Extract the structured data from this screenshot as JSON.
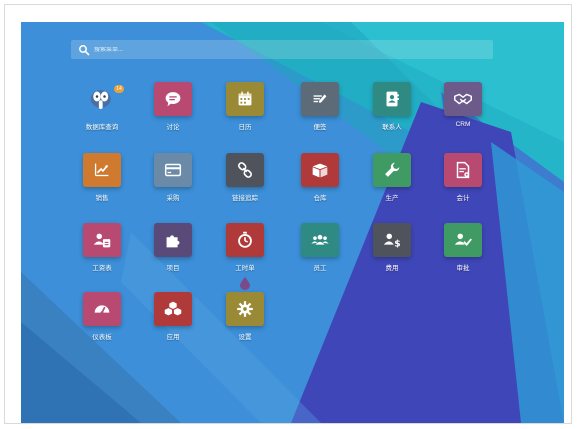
{
  "search": {
    "placeholder": "搜索菜单..."
  },
  "colors": {
    "background": "#3c8fd8",
    "tile_purple": "#6b4f7a",
    "tile_pink": "#b84a72",
    "tile_olive": "#9a8a35",
    "tile_gray": "#5d6a78",
    "tile_teal": "#2f8a84",
    "tile_orange": "#d07a2f",
    "tile_steel": "#6a8aa8",
    "tile_dark": "#4f545c",
    "tile_red": "#b03a3a",
    "tile_green": "#3f9a64",
    "tile_violet": "#5a4a7a"
  },
  "apps": [
    {
      "label": "数据库查询",
      "icon": "database-elephant-icon",
      "badge": "14"
    },
    {
      "label": "讨论",
      "icon": "chat-icon"
    },
    {
      "label": "日历",
      "icon": "calendar-icon"
    },
    {
      "label": "便签",
      "icon": "note-icon"
    },
    {
      "label": "联系人",
      "icon": "contact-book-icon"
    },
    {
      "label": "CRM",
      "icon": "handshake-icon"
    },
    {
      "label": "销售",
      "icon": "sales-chart-icon"
    },
    {
      "label": "采购",
      "icon": "credit-card-icon"
    },
    {
      "label": "链接追踪",
      "icon": "link-icon"
    },
    {
      "label": "仓库",
      "icon": "box-icon"
    },
    {
      "label": "生产",
      "icon": "wrench-icon"
    },
    {
      "label": "会计",
      "icon": "invoice-icon"
    },
    {
      "label": "工资表",
      "icon": "payroll-icon"
    },
    {
      "label": "项目",
      "icon": "puzzle-icon"
    },
    {
      "label": "工时单",
      "icon": "stopwatch-icon"
    },
    {
      "label": "员工",
      "icon": "employees-icon"
    },
    {
      "label": "费用",
      "icon": "expense-icon"
    },
    {
      "label": "审批",
      "icon": "approval-icon"
    },
    {
      "label": "仪表板",
      "icon": "dashboard-gauge-icon"
    },
    {
      "label": "应用",
      "icon": "apps-cubes-icon"
    },
    {
      "label": "设置",
      "icon": "settings-gear-icon"
    }
  ]
}
